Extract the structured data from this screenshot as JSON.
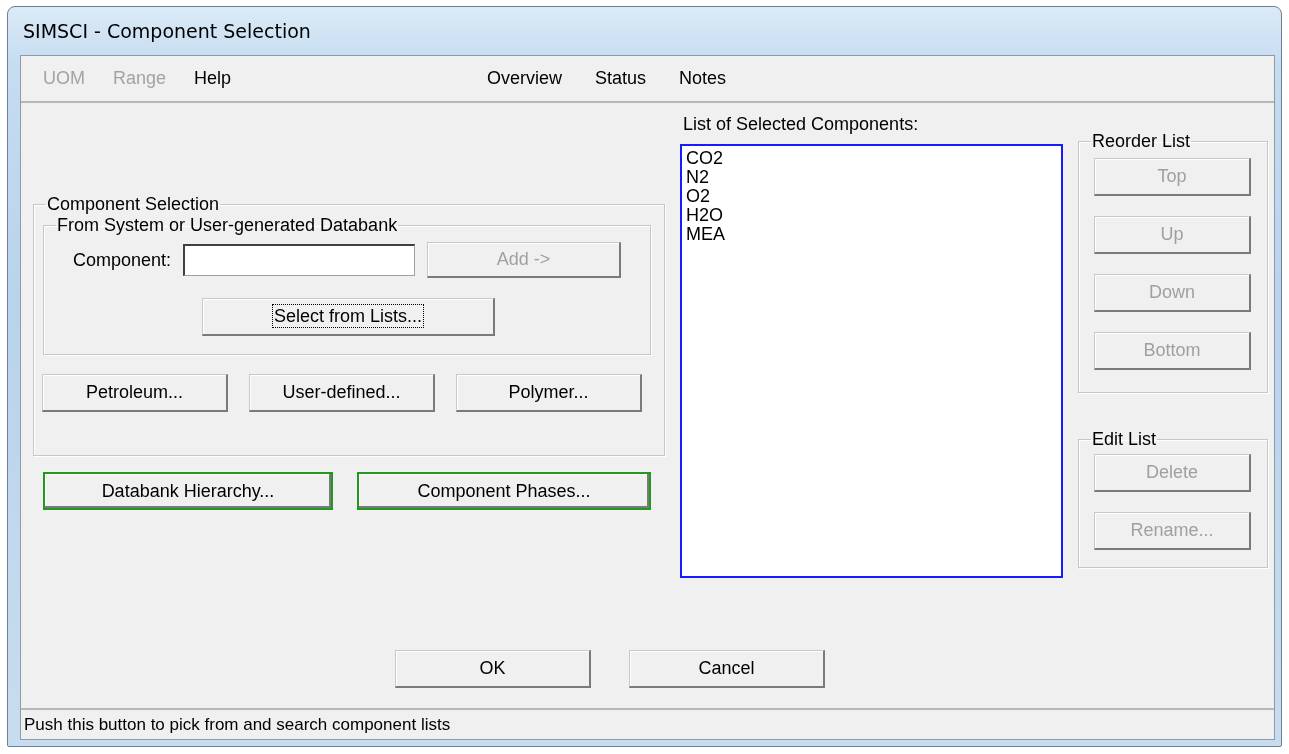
{
  "window": {
    "title": "SIMSCI - Component Selection"
  },
  "menu_left": [
    {
      "label": "UOM",
      "disabled": true
    },
    {
      "label": "Range",
      "disabled": true
    },
    {
      "label": "Help",
      "disabled": false
    }
  ],
  "menu_right": [
    {
      "label": "Overview",
      "disabled": false
    },
    {
      "label": "Status",
      "disabled": false
    },
    {
      "label": "Notes",
      "disabled": false
    }
  ],
  "component_selection": {
    "title": "Component Selection",
    "databank_group": {
      "title": "From System or User-generated Databank",
      "component_label": "Component:",
      "add_button": {
        "label": "Add ->",
        "disabled": true
      },
      "select_button": {
        "label": "Select from Lists...",
        "disabled": false,
        "focused": true
      }
    },
    "buttons": [
      {
        "label": "Petroleum...",
        "disabled": false
      },
      {
        "label": "User-defined...",
        "disabled": false
      },
      {
        "label": "Polymer...",
        "disabled": false
      }
    ]
  },
  "extra_buttons": [
    {
      "label": "Databank Hierarchy...",
      "highlighted": true
    },
    {
      "label": "Component Phases...",
      "highlighted": true
    }
  ],
  "selected_list": {
    "label": "List of Selected Components:",
    "items": [
      {
        "name": "CO2",
        "selected": false
      },
      {
        "name": "N2",
        "selected": false
      },
      {
        "name": "O2",
        "selected": false
      },
      {
        "name": "H2O",
        "selected": false
      },
      {
        "name": "MEA",
        "selected": false
      }
    ]
  },
  "reorder_list": {
    "title": "Reorder List",
    "buttons": [
      {
        "label": "Top",
        "disabled": true
      },
      {
        "label": "Up",
        "disabled": true
      },
      {
        "label": "Down",
        "disabled": true
      },
      {
        "label": "Bottom",
        "disabled": true
      }
    ]
  },
  "edit_list": {
    "title": "Edit List",
    "buttons": [
      {
        "label": "Delete",
        "disabled": true
      },
      {
        "label": "Rename...",
        "disabled": true
      }
    ]
  },
  "dialog_buttons": [
    {
      "label": "OK"
    },
    {
      "label": "Cancel"
    }
  ],
  "status_bar": "Push this button to pick from and search component lists"
}
